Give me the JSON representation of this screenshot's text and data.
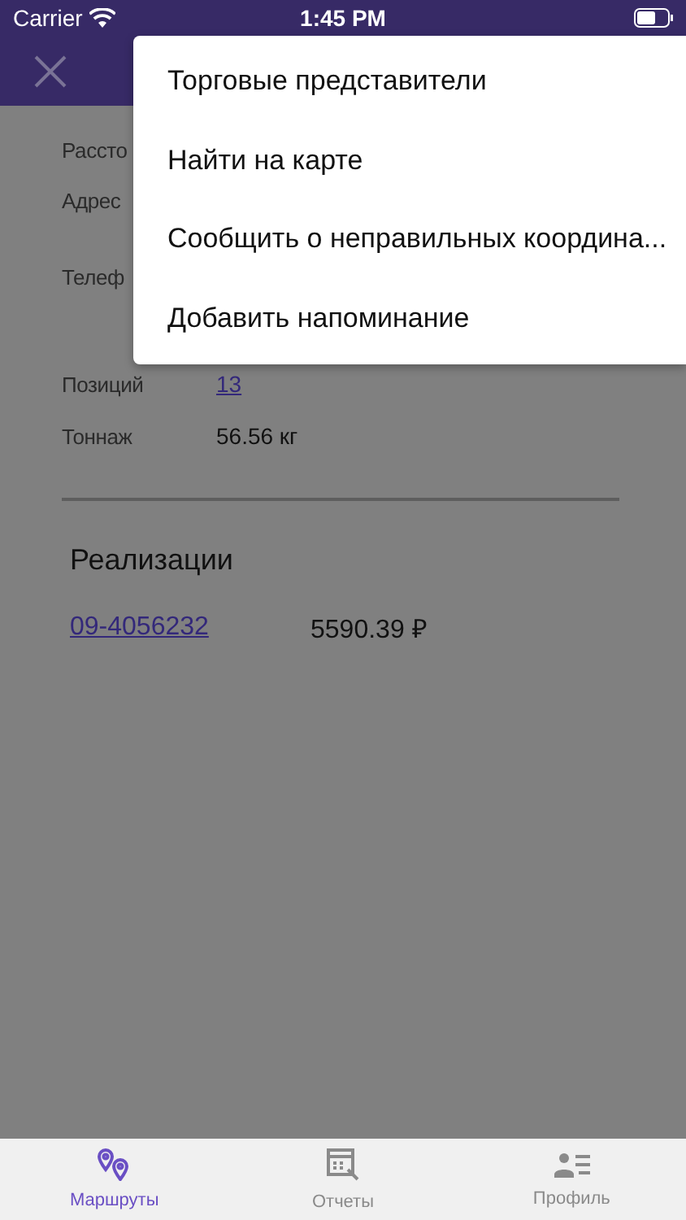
{
  "status_bar": {
    "carrier": "Carrier",
    "time": "1:45 PM"
  },
  "details": [
    {
      "label": "Рассто"
    },
    {
      "label": "Адрес"
    },
    {
      "label": "Телеф"
    },
    {
      "label": "Позиций",
      "value": "13",
      "kind": "link"
    },
    {
      "label": "Тоннаж",
      "value": "56.56 кг",
      "kind": "text"
    }
  ],
  "section": {
    "title": "Реализации",
    "rows": [
      {
        "number": "09-4056232",
        "amount": "5590.39 ₽"
      }
    ]
  },
  "menu": {
    "items": [
      "Торговые представители",
      "Найти на карте",
      "Сообщить о неправильных координа...",
      "Добавить напоминание"
    ]
  },
  "tabs": [
    {
      "label": "Маршруты",
      "kind": "routes",
      "selected": true
    },
    {
      "label": "Отчеты",
      "kind": "reports",
      "selected": false
    },
    {
      "label": "Профиль",
      "kind": "profile",
      "selected": false
    }
  ]
}
